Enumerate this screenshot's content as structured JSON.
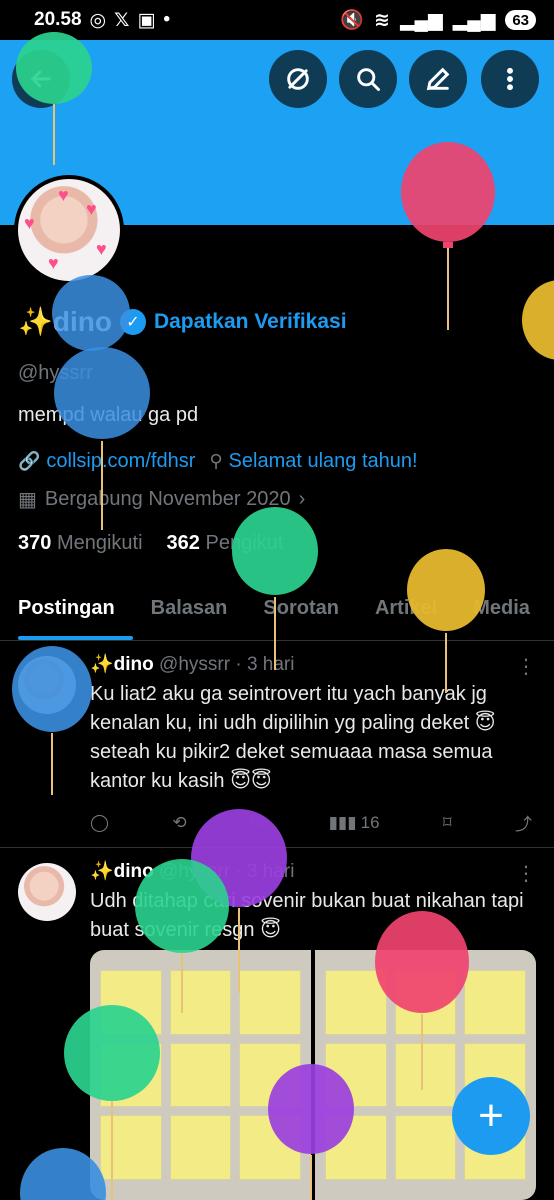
{
  "status_bar": {
    "time": "20.58",
    "battery": "63"
  },
  "header": {
    "back_icon": "arrow-left-icon",
    "grok_icon": "slash-circle-icon",
    "search_icon": "search-icon",
    "edit_icon": "pencil-icon",
    "more_icon": "more-vertical-icon"
  },
  "profile": {
    "name": "✨dino",
    "verify_label": "Dapatkan Verifikasi",
    "handle": "@hyssrr",
    "bio": "mempd walau ga pd",
    "link": "collsip.com/fdhsr",
    "location": "Selamat ulang tahun!",
    "joined": "Bergabung November 2020",
    "following_count": "370",
    "following_label": "Mengikuti",
    "followers_count": "362",
    "followers_label": "Pengikut"
  },
  "tabs": [
    "Postingan",
    "Balasan",
    "Sorotan",
    "Artikel",
    "Media"
  ],
  "posts": [
    {
      "name": "✨dino",
      "handle_time": "@hyssrr · 3 hari",
      "text": "Ku liat2 aku ga seintrovert itu yach banyak jg kenalan ku, ini udh dipilihin yg paling deket 😇 seteah ku pikir2 deket semuaaa masa semua kantor ku kasih 😇😇",
      "views": "16"
    },
    {
      "name": "✨dino",
      "handle_time": "@hyssrr · 3 hari",
      "text": "Udh ditahap cari sovenir bukan buat nikahan tapi buat sovenir resgn 😇"
    }
  ],
  "colors": {
    "banner": "#1da1f2",
    "accent": "#1d9bf0"
  }
}
